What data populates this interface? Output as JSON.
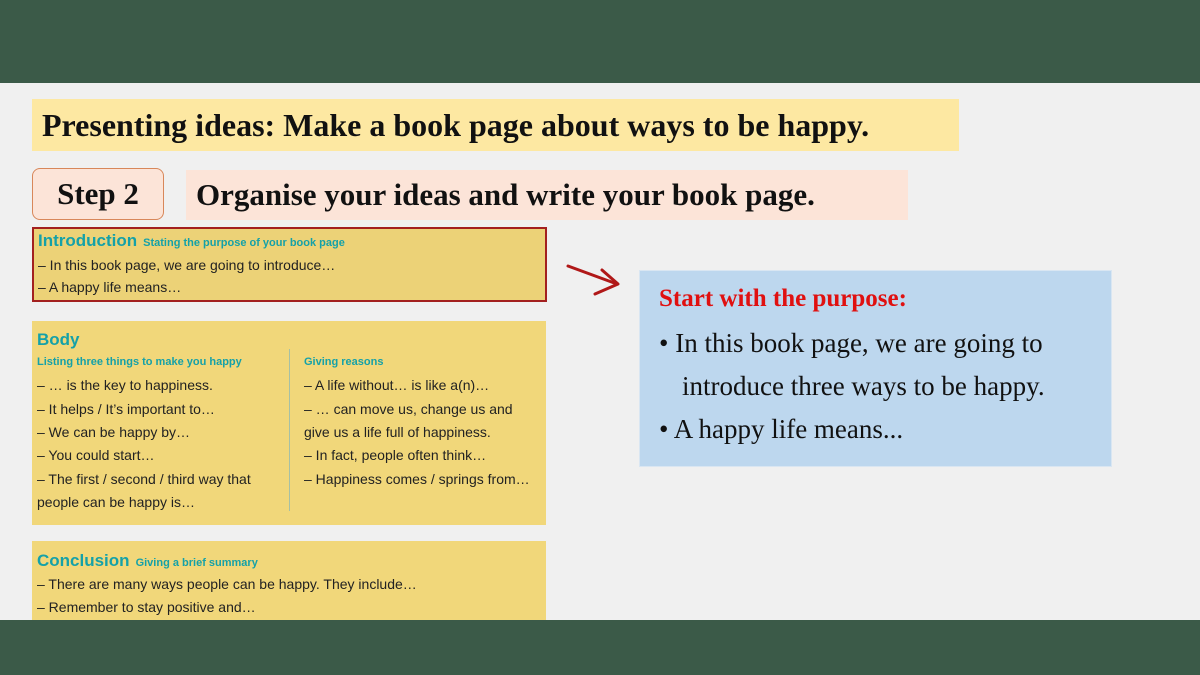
{
  "header": {
    "title": "Presenting ideas: Make a book page about ways to be happy."
  },
  "step": {
    "label": "Step 2",
    "instruction": "Organise your ideas and write your book page."
  },
  "introduction": {
    "heading": "Introduction",
    "subheading": "Stating the purpose of your book page",
    "lines": [
      "–  In this book page, we are going to introduce…",
      "–  A happy life means…"
    ]
  },
  "body": {
    "heading": "Body",
    "left": {
      "subheading": "Listing three things to make you happy",
      "lines": [
        "–  … is the key to happiness.",
        "–  It helps / It’s important to…",
        "–  We can be happy by…",
        "–  You could start…",
        "–  The first / second / third way that",
        "    people can be happy is…"
      ]
    },
    "right": {
      "subheading": "Giving reasons",
      "lines": [
        "–  A life without… is like a(n)…",
        "–  … can move us, change us and",
        "    give us a life full of happiness.",
        "–  In fact, people often think…",
        "–  Happiness comes / springs from…"
      ]
    }
  },
  "conclusion": {
    "heading": "Conclusion",
    "subheading": "Giving a brief summary",
    "lines": [
      "–  There are many ways people can be happy. They include…",
      "–  Remember to stay positive and…"
    ]
  },
  "callout": {
    "title": "Start with the purpose:",
    "lines": [
      "• In this book page, we are going to",
      "introduce three ways to be happy.",
      "• A happy life means..."
    ]
  },
  "colors": {
    "band": "#3b5a48",
    "title_bg": "#fde8a2",
    "step_bg": "#fce4d8",
    "panel_bg": "#f1d77a",
    "heading_teal": "#15a1a8",
    "highlight_border": "#a3201f",
    "callout_bg": "#bdd7ee",
    "callout_title": "#e01010"
  },
  "icons": {
    "pointer": "arrow-right-icon"
  }
}
